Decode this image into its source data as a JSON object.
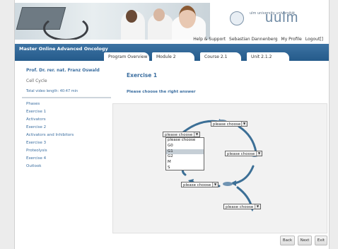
{
  "header": {
    "logo_small": "ulm university  universität",
    "logo_big": "uulm",
    "top_links": [
      "Help & Support",
      "Sebastian Dannenberg",
      "My Profile",
      "Logout[]"
    ]
  },
  "nav": {
    "course_title": "Master Online Advanced Oncology",
    "tabs": [
      "Program Overview",
      "Module 2",
      "Course 2.1",
      "Unit 2.1.2"
    ]
  },
  "sidebar": {
    "professor": "Prof. Dr. rer. nat. Franz Oswald",
    "topic": "Cell Cycle",
    "video_length": "Total video length: 40:47 min",
    "items": [
      "Phases",
      "Exercise 1",
      "Activators",
      "Exercise 2",
      "Activators and Inhibitors",
      "Exercise 3",
      "Proteolysis",
      "Exercise 4",
      "Outlook"
    ]
  },
  "exercise": {
    "title": "Exercise 1",
    "prompt": "Please choose the right answer",
    "select_placeholder": "please choose",
    "dropdown_options": [
      "please choose",
      "G0",
      "G1",
      "G2",
      "M",
      "S"
    ],
    "highlighted_option": "G1"
  },
  "footer": {
    "back": "Back",
    "next": "Next",
    "exit": "Exit"
  },
  "colors": {
    "nav_bar": "#2e659a",
    "link_blue": "#3b6ea0",
    "cycle_arrow": "#3c6f96"
  }
}
